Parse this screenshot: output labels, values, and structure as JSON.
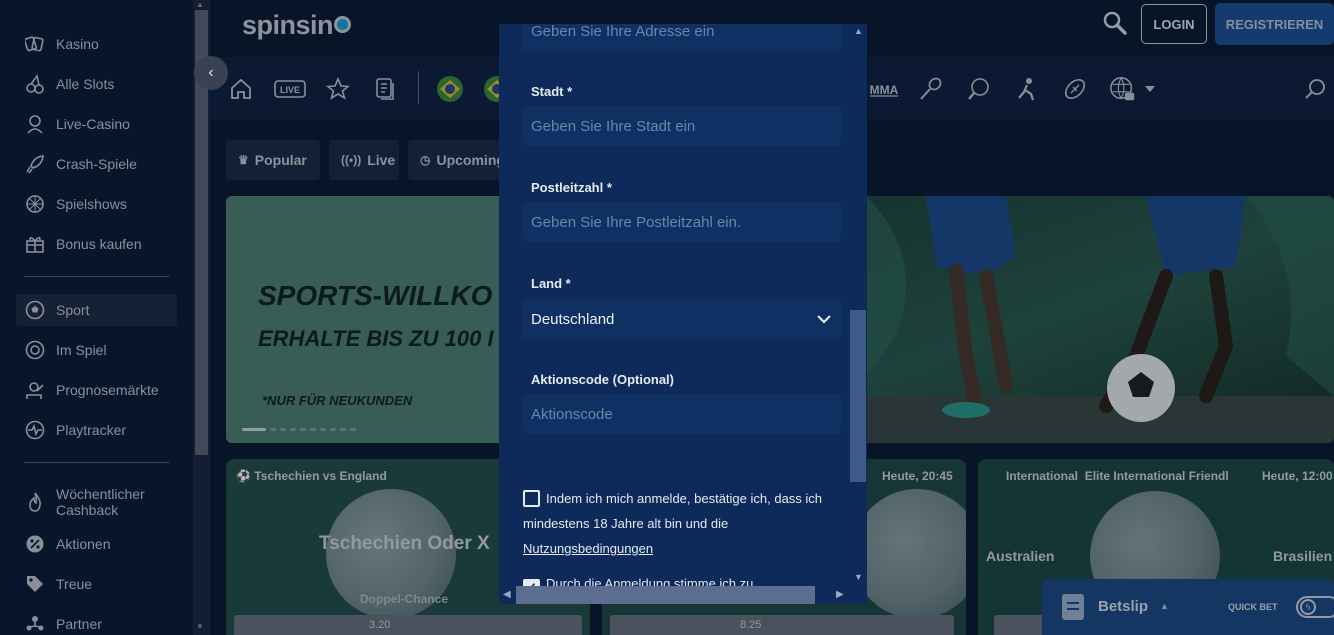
{
  "sidebar": {
    "items": [
      {
        "label": "Kasino",
        "icon": "cards-icon"
      },
      {
        "label": "Alle Slots",
        "icon": "cherries-icon"
      },
      {
        "label": "Live-Casino",
        "icon": "dealer-icon"
      },
      {
        "label": "Crash-Spiele",
        "icon": "rocket-icon"
      },
      {
        "label": "Spielshows",
        "icon": "wheel-icon"
      },
      {
        "label": "Bonus kaufen",
        "icon": "gift-box-icon"
      }
    ],
    "sport_items": [
      {
        "label": "Sport",
        "icon": "soccer-ball-icon",
        "active": true
      },
      {
        "label": "Im Spiel",
        "icon": "live-ball-icon"
      },
      {
        "label": "Prognosemärkte",
        "icon": "market-icon"
      },
      {
        "label": "Playtracker",
        "icon": "pulse-icon"
      }
    ],
    "promo_items": [
      {
        "label": "Wöchentlicher Cashback",
        "line1": "Wöchentlicher",
        "line2": "Cashback",
        "icon": "flame-icon"
      },
      {
        "label": "Aktionen",
        "icon": "percent-icon"
      },
      {
        "label": "Treue",
        "icon": "tag-icon"
      },
      {
        "label": "Partner",
        "icon": "partner-icon"
      }
    ]
  },
  "header": {
    "logo": "spinsin",
    "login": "LOGIN",
    "register": "REGISTRIEREN"
  },
  "sport_nav": {
    "icons": [
      "home-icon",
      "live-icon",
      "star-icon",
      "betslip-list-icon",
      "flag-brazil-icon",
      "flag-brazil-icon",
      "mma-icon",
      "badminton-icon",
      "table-tennis-icon",
      "hockey-icon",
      "american-football-icon",
      "esports-icon"
    ],
    "live_label": "LIVE",
    "mma_label": "MMA"
  },
  "tabs": [
    {
      "label": "Popular",
      "icon": "crown-icon"
    },
    {
      "label": "Live",
      "icon": "live-signal-icon"
    },
    {
      "label": "Upcoming",
      "icon": "clock-icon"
    }
  ],
  "banner": {
    "headline": "SPORTS-WILLKO",
    "subline": "ERHALTE BIS ZU 100 I",
    "note": "*NUR FÜR NEUKUNDEN"
  },
  "cards": [
    {
      "meta": "Tschechien vs England",
      "title": "Tschechien Oder X",
      "sub": "Doppel-Chance",
      "odds": "3.20"
    },
    {
      "meta": "Heute, 20:45",
      "odds": "8.25"
    },
    {
      "meta_left": "International",
      "meta_mid": "Elite International Friendl",
      "meta_right": "Heute, 12:00",
      "home": "Australien",
      "away": "Brasilien"
    }
  ],
  "modal": {
    "address_placeholder": "Geben Sie Ihre Adresse ein",
    "city_label": "Stadt *",
    "city_placeholder": "Geben Sie Ihre Stadt ein",
    "zip_label": "Postleitzahl *",
    "zip_placeholder": "Geben Sie Ihre Postleitzahl ein.",
    "country_label": "Land *",
    "country_value": "Deutschland",
    "promo_label": "Aktionscode (Optional)",
    "promo_placeholder": "Aktionscode",
    "terms_text": "Indem ich mich anmelde, bestätige ich, dass ich mindestens 18 Jahre alt bin und die",
    "terms_link": "Nutzungsbedingungen",
    "consent_text": "Durch die Anmeldung stimme ich zu"
  },
  "betslip": {
    "label": "Betslip",
    "quick_bet": "QUICK BET"
  },
  "colors": {
    "modal_bg": "#0d2a5a",
    "register_bg": "#1c4f95",
    "betslip_bg": "#1a4a86"
  }
}
